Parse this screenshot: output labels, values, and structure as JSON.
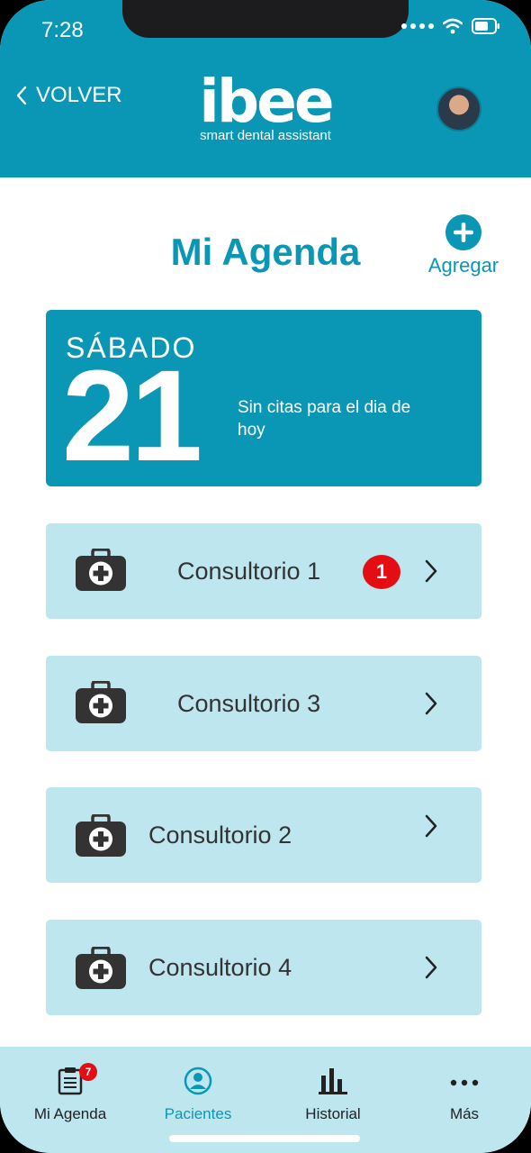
{
  "status": {
    "time": "7:28"
  },
  "header": {
    "back_label": "VOLVER",
    "logo_word": "ibee",
    "logo_tagline": "smart dental assistant"
  },
  "page": {
    "title": "Mi Agenda",
    "add_label": "Agregar"
  },
  "day": {
    "name": "SÁBADO",
    "number": "21",
    "message": "Sin citas para el dia de hoy"
  },
  "offices": [
    {
      "label": "Consultorio 1",
      "badge": "1"
    },
    {
      "label": "Consultorio 3"
    },
    {
      "label": "Consultorio 2"
    },
    {
      "label": "Consultorio 4"
    }
  ],
  "tabs": [
    {
      "label": "Mi Agenda",
      "badge": "7",
      "icon": "agenda-icon"
    },
    {
      "label": "Pacientes",
      "icon": "patients-icon",
      "active": true
    },
    {
      "label": "Historial",
      "icon": "chart-icon"
    },
    {
      "label": "Más",
      "icon": "more-icon"
    }
  ],
  "colors": {
    "primary": "#0a97b5",
    "card_bg": "#bde6ef",
    "badge": "#e30d13"
  }
}
